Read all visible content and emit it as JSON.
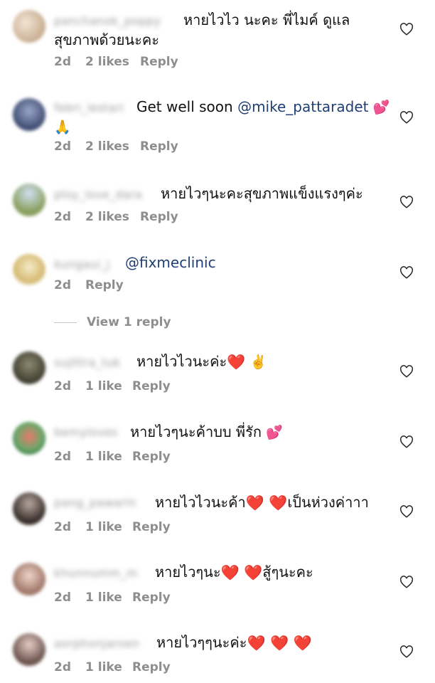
{
  "comments": [
    {
      "username": "panchanok_poppy",
      "text_line1": "หายไวไว นะคะ พี่ไมค์ ดูแล",
      "text_line2": "สุขภาพด้วยนะคะ",
      "time": "2d",
      "likes": "2 likes",
      "reply": "Reply",
      "avatar_color": "#d9c7b0"
    },
    {
      "username": "febri_lestari",
      "text_prefix": "Get well soon ",
      "mention": "@mike_pattaradet",
      "emoji1": "💕",
      "emoji2": "🙏",
      "time": "2d",
      "likes": "2 likes",
      "reply": "Reply",
      "avatar_color": "#5a6f9a"
    },
    {
      "username": "ploy_love_dara",
      "text": "หายไวๆนะคะสุขภาพแข็งแรงๆค่ะ",
      "time": "2d",
      "likes": "2 likes",
      "reply": "Reply",
      "avatar_color": "#9fb07a"
    },
    {
      "username": "kungaui_j",
      "mention": "@fixmeclinic",
      "time": "2d",
      "reply": "Reply",
      "avatar_color": "#e9d9a8"
    },
    {
      "username": "sujittra_tuk",
      "text": "หายไวไวนะค่ะ",
      "emoji1": "❤️",
      "emoji2": "✌️",
      "time": "2d",
      "likes": "1 like",
      "reply": "Reply",
      "avatar_color": "#6b6a55"
    },
    {
      "username": "bemyloves",
      "text": "หายไวๆนะค้าบบ  พี่รัก",
      "emoji1": "💕",
      "time": "2d",
      "likes": "1 like",
      "reply": "Reply",
      "avatar_color": "#6aa86a"
    },
    {
      "username": "pang_pawarin",
      "text_a": "หายไวไวนะค้า",
      "text_b": "เป็นห่วงค่าาา",
      "heart": "❤️",
      "time": "2d",
      "likes": "1 like",
      "reply": "Reply",
      "avatar_color": "#4a3f3a"
    },
    {
      "username": "khunnumm_m",
      "text_a": "หายไวๆนะ",
      "text_b": "สู้ๆนะคะ",
      "heart": "❤️",
      "time": "2d",
      "likes": "1 like",
      "reply": "Reply",
      "avatar_color": "#b58d7a"
    },
    {
      "username": "aorphonjaroen",
      "text": "หายไวๆๆนะค่ะ",
      "heart": "❤️",
      "time": "2d",
      "likes": "1 like",
      "reply": "Reply",
      "avatar_color": "#8a6f66"
    }
  ],
  "view_replies": "View 1 reply",
  "icons": {
    "like": "heart-outline-icon"
  }
}
